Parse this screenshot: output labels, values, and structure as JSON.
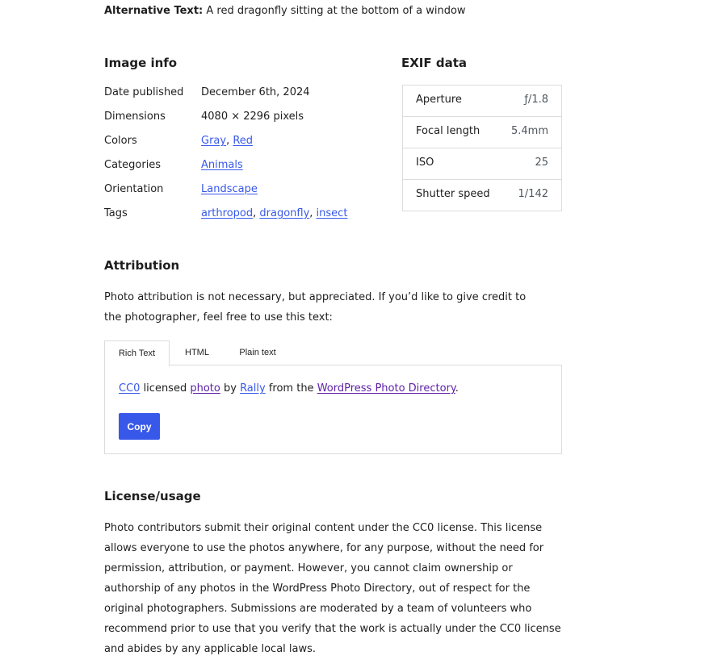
{
  "alt_text": {
    "label": "Alternative Text:",
    "value": " A red dragonfly sitting at the bottom of a window"
  },
  "image_info": {
    "heading": "Image info",
    "date_published": {
      "label": "Date published",
      "value": "December 6th, 2024"
    },
    "dimensions": {
      "label": "Dimensions",
      "value": "4080 × 2296 pixels"
    },
    "colors": {
      "label": "Colors",
      "links": [
        "Gray",
        "Red"
      ],
      "separator": ", "
    },
    "categories": {
      "label": "Categories",
      "links": [
        "Animals"
      ]
    },
    "orientation": {
      "label": "Orientation",
      "links": [
        "Landscape"
      ]
    },
    "tags": {
      "label": "Tags",
      "links": [
        "arthropod",
        "dragonfly",
        "insect"
      ],
      "separator": ", "
    }
  },
  "exif": {
    "heading": "EXIF data",
    "rows": [
      {
        "label": "Aperture",
        "value": "ƒ/1.8"
      },
      {
        "label": "Focal length",
        "value": "5.4mm"
      },
      {
        "label": "ISO",
        "value": "25"
      },
      {
        "label": "Shutter speed",
        "value": "1/142"
      }
    ]
  },
  "attribution": {
    "heading": "Attribution",
    "description": "Photo attribution is not necessary, but appreciated. If you’d like to give credit to the photographer, feel free to use this text:",
    "tabs": [
      {
        "label": "Rich Text",
        "active": true
      },
      {
        "label": "HTML",
        "active": false
      },
      {
        "label": "Plain text",
        "active": false
      }
    ],
    "credit": {
      "license_link": "CC0",
      "text_1": " licensed ",
      "photo_link": "photo",
      "text_2": " by ",
      "author_link": "Rally",
      "text_3": " from the ",
      "directory_link": "WordPress Photo Directory",
      "text_4": "."
    },
    "copy_button": "Copy"
  },
  "license": {
    "heading": "License/usage",
    "text": "Photo contributors submit their original content under the CC0 license. This license allows everyone to use the photos anywhere, for any purpose, without the need for permission, attribution, or payment. However, you cannot claim ownership or authorship of any photos in the WordPress Photo Directory, out of respect for the original photographers. Submissions are moderated by a team of volunteers who recommend prior to use that you verify that the work is actually under the CC0 license and abides by any applicable local laws."
  },
  "colors": {
    "accent": "#3858e9",
    "visited_link": "#5d1fa8",
    "text": "#1e1e1e",
    "border": "#dcdcde"
  }
}
